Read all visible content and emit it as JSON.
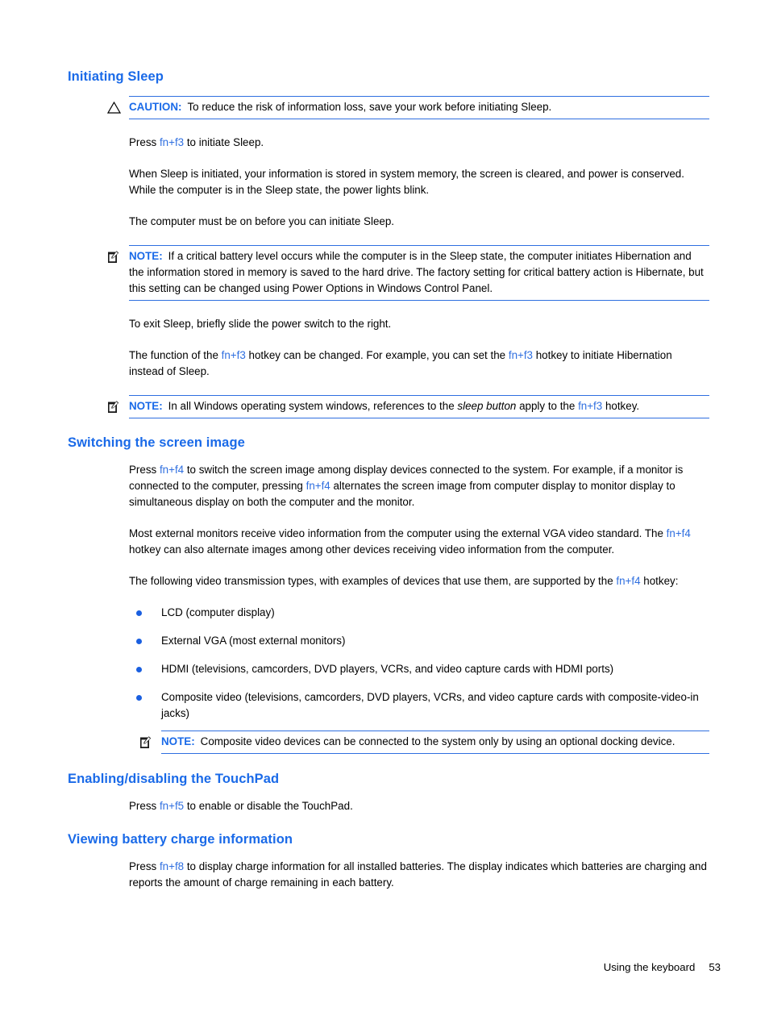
{
  "page": {
    "footer_text": "Using the keyboard",
    "page_number": "53"
  },
  "colors": {
    "heading_blue": "#1a6ae8",
    "link_blue": "#2f6fe0",
    "rule_blue": "#2f6fe0",
    "bullet_blue": "#1a5fe0",
    "body_black": "#000000"
  },
  "sections": [
    {
      "heading": "Initiating Sleep",
      "caution": {
        "label": "CAUTION:",
        "icon": "warning-triangle-icon",
        "text": "To reduce the risk of information loss, save your work before initiating Sleep."
      },
      "p1_a": "Press ",
      "p1_key": "fn+f3",
      "p1_b": " to initiate Sleep.",
      "p2": "When Sleep is initiated, your information is stored in system memory, the screen is cleared, and power is conserved. While the computer is in the Sleep state, the power lights blink.",
      "p3": "The computer must be on before you can initiate Sleep.",
      "note1": {
        "label": "NOTE:",
        "icon": "note-memo-icon",
        "text": "If a critical battery level occurs while the computer is in the Sleep state, the computer initiates Hibernation and the information stored in memory is saved to the hard drive. The factory setting for critical battery action is Hibernate, but this setting can be changed using Power Options in Windows Control Panel."
      },
      "p4": "To exit Sleep, briefly slide the power switch to the right.",
      "p5_a": "The function of the ",
      "p5_key1": "fn+f3",
      "p5_b": " hotkey can be changed. For example, you can set the ",
      "p5_key2": "fn+f3",
      "p5_c": " hotkey to initiate Hibernation instead of Sleep.",
      "note2": {
        "label": "NOTE:",
        "icon": "note-memo-icon",
        "text_a": "In all Windows operating system windows, references to the ",
        "text_italic": "sleep button",
        "text_b": " apply to the ",
        "text_key": "fn+f3",
        "text_c": " hotkey."
      }
    },
    {
      "heading": "Switching the screen image",
      "p1_a": "Press ",
      "p1_key1": "fn+f4",
      "p1_b": " to switch the screen image among display devices connected to the system. For example, if a monitor is connected to the computer, pressing ",
      "p1_key2": "fn+f4",
      "p1_c": " alternates the screen image from computer display to monitor display to simultaneous display on both the computer and the monitor.",
      "p2_a": "Most external monitors receive video information from the computer using the external VGA video standard. The ",
      "p2_key": "fn+f4",
      "p2_b": " hotkey can also alternate images among other devices receiving video information from the computer.",
      "p3_a": "The following video transmission types, with examples of devices that use them, are supported by the ",
      "p3_key": "fn+f4",
      "p3_b": " hotkey:",
      "bullets": [
        "LCD (computer display)",
        "External VGA (most external monitors)",
        "HDMI (televisions, camcorders, DVD players, VCRs, and video capture cards with HDMI ports)",
        "Composite video (televisions, camcorders, DVD players, VCRs, and video capture cards with composite-video-in jacks)"
      ],
      "note3": {
        "label": "NOTE:",
        "icon": "note-memo-icon",
        "text": "Composite video devices can be connected to the system only by using an optional docking device."
      }
    },
    {
      "heading": "Enabling/disabling the TouchPad",
      "p1_a": "Press ",
      "p1_key": "fn+f5",
      "p1_b": " to enable or disable the TouchPad."
    },
    {
      "heading": "Viewing battery charge information",
      "p1_a": "Press ",
      "p1_key": "fn+f8",
      "p1_b": " to display charge information for all installed batteries. The display indicates which batteries are charging and reports the amount of charge remaining in each battery."
    }
  ]
}
